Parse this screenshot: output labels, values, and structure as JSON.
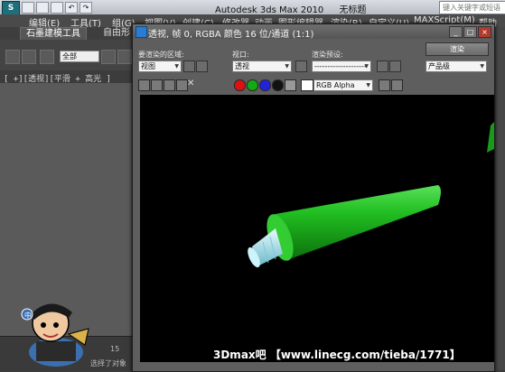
{
  "app": {
    "logo": "S",
    "title": "Autodesk 3ds Max  2010",
    "document": "无标题",
    "search_placeholder": "键入关键字或短语"
  },
  "menu": [
    "编辑(E)",
    "工具(T)",
    "组(G)",
    "视图(V)",
    "创建(C)",
    "修改器",
    "动画",
    "图形编辑器",
    "渲染(R)",
    "自定义(U)",
    "MAXScript(M)",
    "帮助(H)"
  ],
  "ribbon": {
    "tab_modeling": "石墨建模工具",
    "tab_freeform": "自由形"
  },
  "left_toolbar": {
    "select_filter": "全部"
  },
  "viewport": {
    "label": "[ +][透视][平滑 + 高光 ]"
  },
  "timeline": {
    "tick": "15",
    "status": "选择了对象"
  },
  "render_window": {
    "title": "透视, 帧 0, RGBA 颜色 16 位/通道 (1:1)",
    "area_label": "要渲染的区域:",
    "area_value": "视图",
    "viewport_label": "视口:",
    "viewport_value": "透视",
    "preset_label": "渲染预设:",
    "preset_value": "--------------------",
    "render_button": "渲染",
    "production_value": "产品级",
    "channel_value": "RGB Alpha",
    "min_glyph": "_",
    "max_glyph": "□",
    "close_glyph": "×"
  },
  "colors": {
    "object_green": "#1fbf1f",
    "object_dark_green": "#0a6a0a",
    "tip_cyan": "#a8e6f0",
    "render_bg": "#000000"
  },
  "watermark": "3Dmax吧 【www.linecg.com/tieba/1771】"
}
